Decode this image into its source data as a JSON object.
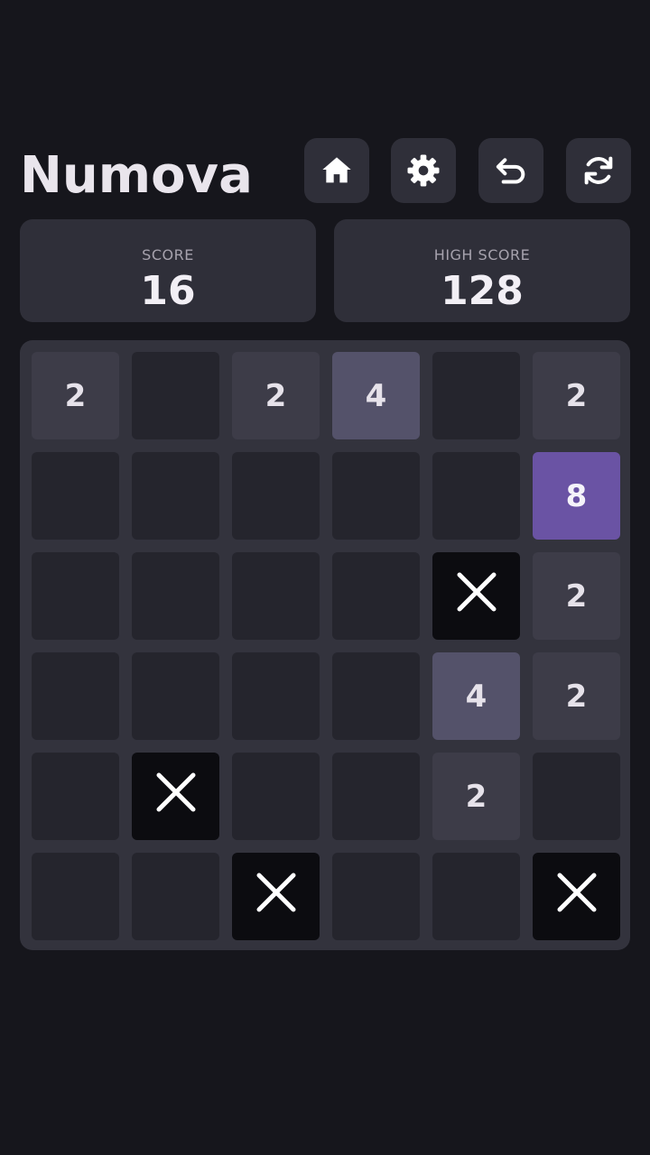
{
  "app": {
    "title": "Numova"
  },
  "toolbar": {
    "buttons": [
      {
        "name": "home-button",
        "icon": "home-icon"
      },
      {
        "name": "settings-button",
        "icon": "gear-icon"
      },
      {
        "name": "undo-button",
        "icon": "undo-icon"
      },
      {
        "name": "restart-button",
        "icon": "restart-icon"
      }
    ]
  },
  "scores": {
    "score_label": "SCORE",
    "score_value": "16",
    "high_score_label": "HIGH SCORE",
    "high_score_value": "128"
  },
  "board": {
    "size": 6,
    "cells": [
      [
        "2",
        "",
        "2",
        "4",
        "",
        "2"
      ],
      [
        "",
        "",
        "",
        "",
        "",
        "8"
      ],
      [
        "",
        "",
        "",
        "",
        "X",
        "2"
      ],
      [
        "",
        "",
        "",
        "",
        "4",
        "2"
      ],
      [
        "",
        "X",
        "",
        "",
        "2",
        ""
      ],
      [
        "",
        "",
        "X",
        "",
        "",
        "X"
      ]
    ]
  },
  "colors": {
    "background": "#16161c",
    "panel": "#2f2f39",
    "board": "#33333d",
    "empty_cell": "#25252d",
    "tile_2": "#3d3c48",
    "tile_4": "#54526a",
    "tile_8": "#6a53a4",
    "blocked_cell": "#0c0c10"
  }
}
